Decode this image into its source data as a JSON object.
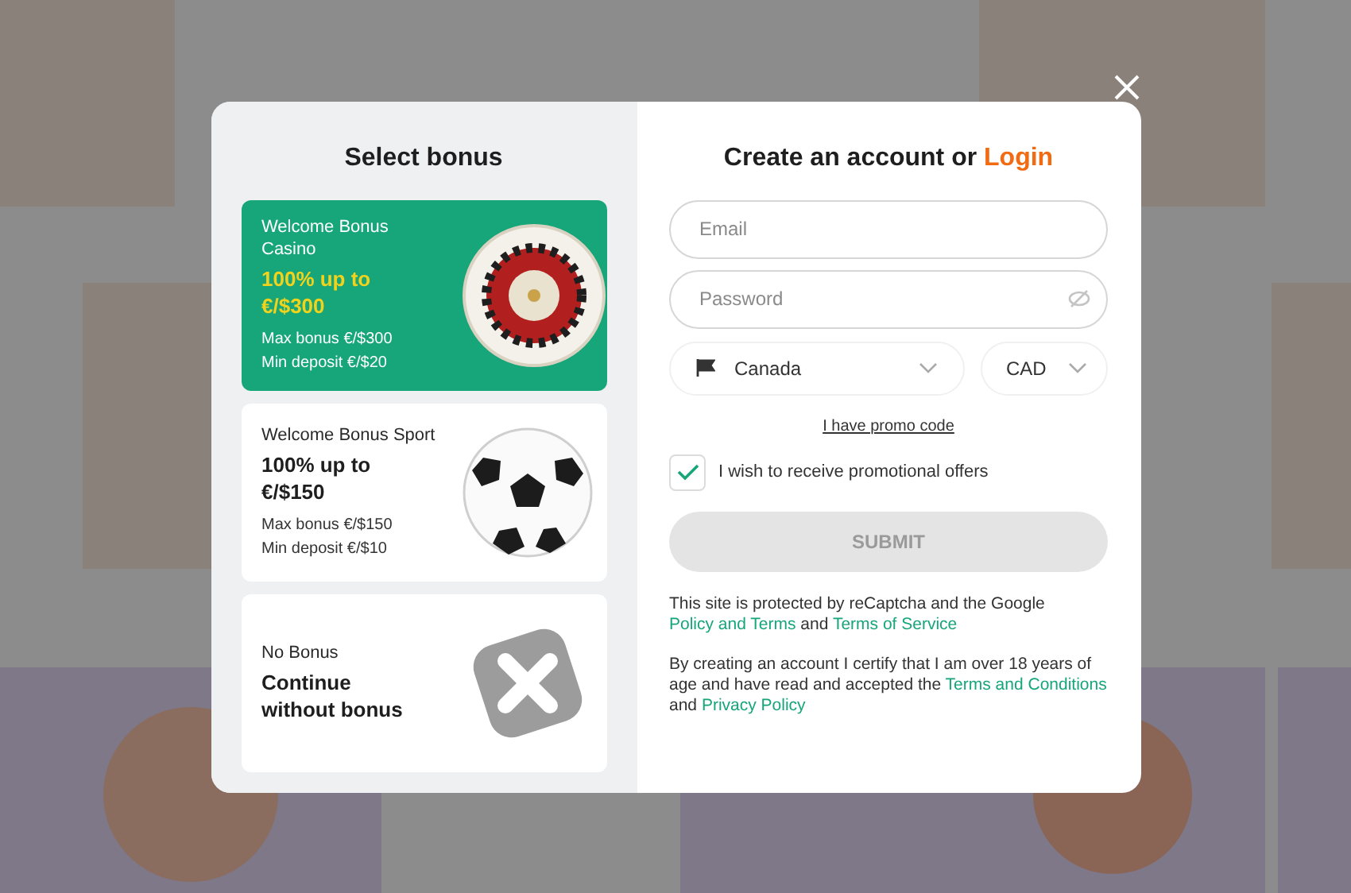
{
  "bonus_panel": {
    "title": "Select bonus",
    "options": [
      {
        "kind": "casino",
        "selected": true,
        "label": "Welcome Bonus Casino",
        "headline": "100% up to €/$300",
        "details": [
          "Max bonus €/$300",
          "Min deposit €/$20"
        ]
      },
      {
        "kind": "sport",
        "selected": false,
        "label": "Welcome Bonus Sport",
        "headline": "100% up to €/$150",
        "details": [
          "Max bonus €/$150",
          "Min deposit €/$10"
        ]
      },
      {
        "kind": "none",
        "selected": false,
        "label": "No Bonus",
        "headline": "Continue without bonus"
      }
    ]
  },
  "form": {
    "title": "Create an account or",
    "login_link": "Login",
    "email": {
      "placeholder": "Email"
    },
    "password": {
      "placeholder": "Password"
    },
    "country": {
      "value": "Canada"
    },
    "currency": {
      "value": "CAD"
    },
    "promo_link": "I have promo code",
    "promo_checkbox": {
      "label": "I wish to receive promotional offers",
      "checked": true
    },
    "submit": {
      "label": "SUBMIT",
      "disabled": true
    },
    "notices": [
      [
        {
          "text": "This site is protected by reCaptcha and the Google ",
          "kind": "text"
        },
        {
          "text": "Policy and Terms",
          "kind": "link"
        },
        {
          "text": " and ",
          "kind": "text"
        },
        {
          "text": "Terms of Service",
          "kind": "link"
        }
      ],
      [
        {
          "text": "By creating an account I certify that I am over 18 years of age and have read and accepted the ",
          "kind": "text"
        },
        {
          "text": "Terms and Conditions",
          "kind": "link"
        },
        {
          "text": " and ",
          "kind": "text"
        },
        {
          "text": "Privacy Policy",
          "kind": "link"
        }
      ]
    ]
  }
}
